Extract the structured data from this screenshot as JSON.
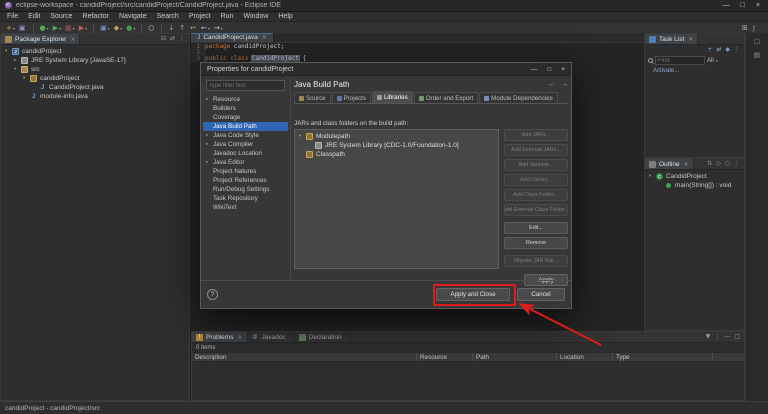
{
  "colors": {
    "selection_blue": "#2f65b5",
    "annotation_red": "#e01b1b",
    "keyword_orange": "#cc7832",
    "java_blue": "#6fa8dc"
  },
  "window": {
    "title": "eclipse-workspace - candidProject/src/candidProject/CandidProject.java - Eclipse IDE",
    "minimize": "—",
    "maximize": "□",
    "close": "×"
  },
  "menubar": {
    "items": [
      {
        "label": "File"
      },
      {
        "label": "Edit"
      },
      {
        "label": "Source"
      },
      {
        "label": "Refactor"
      },
      {
        "label": "Navigate"
      },
      {
        "label": "Search"
      },
      {
        "label": "Project"
      },
      {
        "label": "Run"
      },
      {
        "label": "Window"
      },
      {
        "label": "Help"
      }
    ]
  },
  "toolbar": {
    "group_file": [
      {
        "name": "new-wizard-icon",
        "glyph": "+",
        "color": "#d2a94f",
        "dd": "▾"
      },
      {
        "name": "save-icon",
        "glyph": "▣",
        "color": "#9d8ec7"
      }
    ],
    "group_launch": [
      {
        "name": "debug-icon",
        "glyph": "●",
        "color": "#58a85c",
        "dd": "▾"
      },
      {
        "name": "run-icon",
        "glyph": "▶",
        "color": "#4fae54",
        "dd": "▾"
      },
      {
        "name": "coverage-icon",
        "glyph": "▦",
        "color": "#a85252",
        "dd": "▾"
      },
      {
        "name": "external-tools-icon",
        "glyph": "▶",
        "color": "#c06060",
        "dd": "▾"
      }
    ],
    "group_new_java": [
      {
        "name": "new-java-project-icon",
        "glyph": "▣",
        "color": "#6f93c4",
        "dd": "▾"
      },
      {
        "name": "new-package-icon",
        "glyph": "◆",
        "color": "#c2a45c",
        "dd": "▾"
      },
      {
        "name": "new-class-icon",
        "glyph": "●",
        "color": "#3f9e4d",
        "dd": "▾"
      }
    ],
    "group_search": [
      {
        "name": "search-icon",
        "glyph": "○",
        "color": "#d8d8d8"
      }
    ],
    "group_nav": [
      {
        "name": "next-annotation-icon",
        "glyph": "↓",
        "color": "#9ab0c4"
      },
      {
        "name": "previous-annotation-icon",
        "glyph": "↑",
        "color": "#9ab0c4"
      },
      {
        "name": "last-edit-location-icon",
        "glyph": "↩",
        "color": "#c2a45c"
      },
      {
        "name": "back-icon",
        "glyph": "←",
        "color": "#d0d0d0",
        "dd": "▾"
      },
      {
        "name": "forward-icon",
        "glyph": "→",
        "color": "#d0d0d0",
        "dd": "▾"
      }
    ],
    "group_perspective": [
      {
        "name": "open-perspective-icon",
        "glyph": "⊞",
        "color": "#b5b5b5"
      },
      {
        "name": "java-perspective-icon",
        "glyph": "J",
        "color": "#6fa8dc"
      }
    ]
  },
  "package_explorer": {
    "tab": "Package Explorer",
    "close": "×",
    "header_icons": [
      {
        "name": "collapse-all-icon",
        "glyph": "⊟"
      },
      {
        "name": "link-with-editor-icon",
        "glyph": "⇄"
      },
      {
        "name": "view-menu-icon",
        "glyph": "⋮"
      }
    ],
    "tree": [
      {
        "tw": "▾",
        "icon": "icon-project",
        "iglyph": "J",
        "label": "candidProject",
        "level": 0
      },
      {
        "tw": "▸",
        "icon": "icon-lib",
        "iglyph": "",
        "label": "JRE System Library [JavaSE-17]",
        "level": 1
      },
      {
        "tw": "▾",
        "icon": "icon-srcfolder",
        "iglyph": "",
        "label": "src",
        "level": 1
      },
      {
        "tw": "▾",
        "icon": "icon-package",
        "iglyph": "",
        "label": "candidProject",
        "level": 2
      },
      {
        "tw": "",
        "icon": "icon-jfile",
        "iglyph": "J",
        "label": "CandidProject.java",
        "level": 3
      },
      {
        "tw": "",
        "icon": "icon-jfile",
        "iglyph": "J",
        "label": "module-info.java",
        "level": 2
      }
    ]
  },
  "editor": {
    "tab_label": "CandidProject.java",
    "tab_icon": "J",
    "tab_close": "×",
    "lines": [
      {
        "num": "1",
        "tokens": [
          {
            "t": "package",
            "c": "kw"
          },
          {
            "t": " candidProject;",
            "c": "pl"
          }
        ]
      },
      {
        "num": "2",
        "tokens": []
      },
      {
        "num": "3",
        "tokens": [
          {
            "t": "public",
            "c": "kw"
          },
          {
            "t": " ",
            "c": "pl"
          },
          {
            "t": "class",
            "c": "kw"
          },
          {
            "t": " ",
            "c": "pl"
          },
          {
            "t": "CandidProject",
            "c": "occ"
          },
          {
            "t": " {",
            "c": "pl"
          }
        ]
      }
    ]
  },
  "task_list": {
    "tab": "Task List",
    "close": "×",
    "toolbar": [
      {
        "name": "new-task-icon",
        "glyph": "+",
        "color": "#6fa8dc"
      },
      {
        "name": "synchronize-icon",
        "glyph": "⇄",
        "color": "#9ab0c4"
      },
      {
        "name": "categorized-icon",
        "glyph": "◆",
        "color": "#7d9bc0"
      },
      {
        "name": "view-menu-icon",
        "glyph": "⋮",
        "color": "#9a9a9a"
      }
    ],
    "find_placeholder": "Find",
    "scope_label": "All",
    "scope_dd": "▾",
    "activate_label": "Activate..."
  },
  "outline": {
    "tab": "Outline",
    "close": "×",
    "header_icons": [
      {
        "name": "sort-icon",
        "glyph": "⇅"
      },
      {
        "name": "hide-fields-icon",
        "glyph": "◇"
      },
      {
        "name": "hide-static-members-icon",
        "glyph": "○"
      },
      {
        "name": "view-menu-icon",
        "glyph": "⋮"
      }
    ],
    "tree": [
      {
        "tw": "▾",
        "icon": "icon-class",
        "iglyph": "C",
        "label": "CandidProject",
        "level": 0
      },
      {
        "tw": "",
        "icon": "icon-method",
        "iglyph": "",
        "label": "main(String[]) : void",
        "level": 1
      }
    ]
  },
  "right_strip": {
    "icons": [
      {
        "name": "minimized-view-icon",
        "glyph": "□"
      },
      {
        "name": "minimized-view-icon",
        "glyph": "▤"
      }
    ]
  },
  "problems": {
    "tabs": [
      {
        "label": "Problems",
        "cls": "active",
        "ic": "ic-problems",
        "iglyph": "!",
        "close": "×"
      },
      {
        "label": "Javadoc",
        "cls": "",
        "ic": "ic-javadoc",
        "iglyph": "@",
        "close": ""
      },
      {
        "label": "Declaration",
        "cls": "",
        "ic": "ic-decl",
        "iglyph": "",
        "close": ""
      }
    ],
    "header_icons": [
      {
        "name": "filter-icon",
        "glyph": "▼"
      },
      {
        "name": "view-menu-icon",
        "glyph": "⋮"
      },
      {
        "name": "minimize-icon",
        "glyph": "—"
      },
      {
        "name": "maximize-icon",
        "glyph": "□"
      }
    ],
    "items_label": "0 items",
    "columns": [
      {
        "label": "Description"
      },
      {
        "label": "Resource"
      },
      {
        "label": "Path"
      },
      {
        "label": "Location"
      },
      {
        "label": "Type"
      }
    ]
  },
  "statusbar": {
    "text": "candidProject - candidProject/src"
  },
  "dialog": {
    "title": "Properties for candidProject",
    "minimize": "—",
    "maximize": "□",
    "close": "×",
    "filter_placeholder": "type filter text",
    "categories": [
      {
        "tw": "▸",
        "label": "Resource",
        "cls": ""
      },
      {
        "tw": "",
        "label": "Builders",
        "cls": ""
      },
      {
        "tw": "",
        "label": "Coverage",
        "cls": ""
      },
      {
        "tw": "",
        "label": "Java Build Path",
        "cls": "selected"
      },
      {
        "tw": "▸",
        "label": "Java Code Style",
        "cls": ""
      },
      {
        "tw": "▸",
        "label": "Java Compiler",
        "cls": ""
      },
      {
        "tw": "",
        "label": "Javadoc Location",
        "cls": ""
      },
      {
        "tw": "▸",
        "label": "Java Editor",
        "cls": ""
      },
      {
        "tw": "",
        "label": "Project Natures",
        "cls": ""
      },
      {
        "tw": "",
        "label": "Project References",
        "cls": ""
      },
      {
        "tw": "",
        "label": "Run/Debug Settings",
        "cls": ""
      },
      {
        "tw": "",
        "label": "Task Repository",
        "cls": ""
      },
      {
        "tw": "",
        "label": "WikiText",
        "cls": ""
      }
    ],
    "page_title": "Java Build Path",
    "nav_icons": [
      {
        "name": "back-icon",
        "glyph": "←"
      },
      {
        "name": "forward-icon",
        "glyph": "→"
      }
    ],
    "tabs": [
      {
        "label": "Source",
        "cls": "",
        "ic": "tabic-source"
      },
      {
        "label": "Projects",
        "cls": "",
        "ic": "tabic-projects"
      },
      {
        "label": "Libraries",
        "cls": "selected",
        "ic": "tabic-libraries"
      },
      {
        "label": "Order and Export",
        "cls": "",
        "ic": "tabic-order"
      },
      {
        "label": "Module Dependencies",
        "cls": "",
        "ic": "tabic-modules"
      }
    ],
    "list_label": "JARs and class folders on the build path:",
    "jar_tree": [
      {
        "tw": "▾",
        "icon": "icon-modulepath",
        "iglyph": "",
        "label": "Modulepath",
        "level": 0
      },
      {
        "tw": "",
        "icon": "icon-lib",
        "iglyph": "",
        "label": "JRE System Library [CDC-1.0/Foundation-1.0]",
        "level": 1
      },
      {
        "tw": "",
        "icon": "icon-classpath",
        "iglyph": "",
        "label": "Classpath",
        "level": 0
      }
    ],
    "side_buttons": [
      {
        "label": "Add JARs...",
        "cls": "disabled"
      },
      {
        "label": "Add External JARs...",
        "cls": "disabled"
      },
      {
        "label": "Add Variable...",
        "cls": "disabled"
      },
      {
        "label": "Add Library...",
        "cls": "disabled"
      },
      {
        "label": "Add Class Folder...",
        "cls": "disabled"
      },
      {
        "label": "Add External Class Folder...",
        "cls": "disabled"
      },
      {
        "label": "Edit...",
        "cls": "gap"
      },
      {
        "label": "Remove",
        "cls": ""
      },
      {
        "label": "Migrate JAR File...",
        "cls": "gap disabled"
      }
    ],
    "apply_label": "Apply",
    "help_label": "?",
    "apply_and_close_label": "Apply and Close",
    "cancel_label": "Cancel"
  },
  "annotation": {
    "color": "#e01b1b",
    "highlights": "Apply and Close"
  }
}
